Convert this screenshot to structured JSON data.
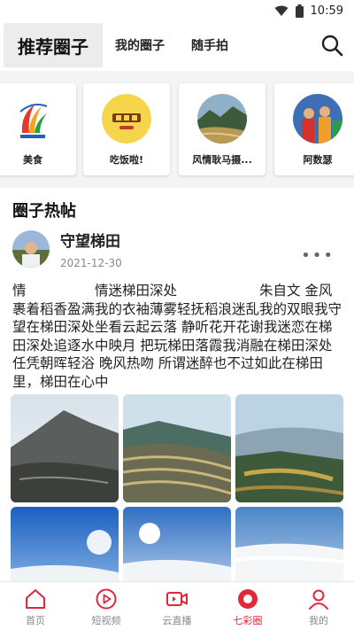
{
  "status_bar": {
    "time": "10:59",
    "icons": [
      "wifi-icon",
      "battery-icon"
    ]
  },
  "top_tabs": {
    "active": "推荐圈子",
    "tabs": [
      "我的圈子",
      "随手拍"
    ],
    "search_icon": "search-icon"
  },
  "circles": [
    {
      "name": "美食"
    },
    {
      "name": "吃饭啦!"
    },
    {
      "name": "风情耿马摄..."
    },
    {
      "name": "阿数瑟"
    }
  ],
  "section_title": "圈子热帖",
  "post": {
    "author": "守望梯田",
    "date": "2021-12-30",
    "text": "情　　　　　情迷梯田深处　　　　　　朱自文 金风裹着稻香盈满我的衣袖薄雾轻抚稻浪迷乱我的双眼我守望在梯田深处坐看云起云落 静听花开花谢我迷恋在梯田深处追逐水中映月 把玩梯田落霞我消融在梯田深处任凭朝晖轻浴 晚风热吻 所谓迷醉也不过如此在梯田里，梯田在心中",
    "photo_count": 6
  },
  "bottom_nav": [
    {
      "label": "首页",
      "icon": "home-icon"
    },
    {
      "label": "短视频",
      "icon": "play-icon"
    },
    {
      "label": "云直播",
      "icon": "live-camera-icon"
    },
    {
      "label": "七彩圈",
      "icon": "circle-icon",
      "active": true
    },
    {
      "label": "我的",
      "icon": "person-icon"
    }
  ],
  "colors": {
    "accent": "#e0283a",
    "inactive": "#888888"
  }
}
